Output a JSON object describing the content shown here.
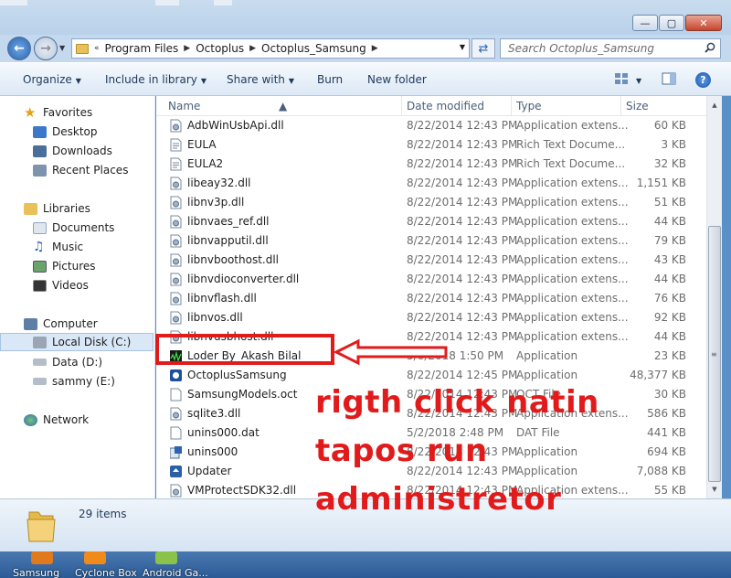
{
  "window": {
    "controls": {
      "minimize": "—",
      "maximize": "▢",
      "close": "✕"
    }
  },
  "address": {
    "crumbs": [
      "Program Files",
      "Octoplus",
      "Octoplus_Samsung"
    ],
    "search_placeholder": "Search Octoplus_Samsung"
  },
  "toolbar": {
    "organize": "Organize",
    "include": "Include in library",
    "share": "Share with",
    "burn": "Burn",
    "new_folder": "New folder"
  },
  "nav": {
    "favorites": "Favorites",
    "desktop": "Desktop",
    "downloads": "Downloads",
    "recent": "Recent Places",
    "libraries": "Libraries",
    "documents": "Documents",
    "music": "Music",
    "pictures": "Pictures",
    "videos": "Videos",
    "computer": "Computer",
    "local_disk": "Local Disk (C:)",
    "data_disk": "Data (D:)",
    "sammy_disk": "sammy (E:)",
    "network": "Network"
  },
  "columns": {
    "name": "Name",
    "date": "Date modified",
    "type": "Type",
    "size": "Size"
  },
  "files": [
    {
      "name": "AdbWinUsbApi.dll",
      "date": "8/22/2014 12:43 PM",
      "type": "Application extens...",
      "size": "60 KB",
      "icon": "dll-icon"
    },
    {
      "name": "EULA",
      "date": "8/22/2014 12:43 PM",
      "type": "Rich Text Docume...",
      "size": "3 KB",
      "icon": "rtf-icon"
    },
    {
      "name": "EULA2",
      "date": "8/22/2014 12:43 PM",
      "type": "Rich Text Docume...",
      "size": "32 KB",
      "icon": "rtf-icon"
    },
    {
      "name": "libeay32.dll",
      "date": "8/22/2014 12:43 PM",
      "type": "Application extens...",
      "size": "1,151 KB",
      "icon": "dll-icon"
    },
    {
      "name": "libnv3p.dll",
      "date": "8/22/2014 12:43 PM",
      "type": "Application extens...",
      "size": "51 KB",
      "icon": "dll-icon"
    },
    {
      "name": "libnvaes_ref.dll",
      "date": "8/22/2014 12:43 PM",
      "type": "Application extens...",
      "size": "44 KB",
      "icon": "dll-icon"
    },
    {
      "name": "libnvapputil.dll",
      "date": "8/22/2014 12:43 PM",
      "type": "Application extens...",
      "size": "79 KB",
      "icon": "dll-icon"
    },
    {
      "name": "libnvboothost.dll",
      "date": "8/22/2014 12:43 PM",
      "type": "Application extens...",
      "size": "43 KB",
      "icon": "dll-icon"
    },
    {
      "name": "libnvdioconverter.dll",
      "date": "8/22/2014 12:43 PM",
      "type": "Application extens...",
      "size": "44 KB",
      "icon": "dll-icon"
    },
    {
      "name": "libnvflash.dll",
      "date": "8/22/2014 12:43 PM",
      "type": "Application extens...",
      "size": "76 KB",
      "icon": "dll-icon"
    },
    {
      "name": "libnvos.dll",
      "date": "8/22/2014 12:43 PM",
      "type": "Application extens...",
      "size": "92 KB",
      "icon": "dll-icon"
    },
    {
      "name": "libnvusbhost.dll",
      "date": "8/22/2014 12:43 PM",
      "type": "Application extens...",
      "size": "44 KB",
      "icon": "dll-icon"
    },
    {
      "name": "Loder By_Akash Bilal",
      "date": "5/6/2018 1:50 PM",
      "type": "Application",
      "size": "23 KB",
      "icon": "loader-app-icon"
    },
    {
      "name": "OctoplusSamsung",
      "date": "8/22/2014 12:45 PM",
      "type": "Application",
      "size": "48,377 KB",
      "icon": "octoplus-app-icon"
    },
    {
      "name": "SamsungModels.oct",
      "date": "8/22/2014 12:43 PM",
      "type": "OCT File",
      "size": "30 KB",
      "icon": "generic-file-icon"
    },
    {
      "name": "sqlite3.dll",
      "date": "8/22/2014 12:43 PM",
      "type": "Application extens...",
      "size": "586 KB",
      "icon": "dll-icon"
    },
    {
      "name": "unins000.dat",
      "date": "5/2/2018 2:48 PM",
      "type": "DAT File",
      "size": "441 KB",
      "icon": "generic-file-icon"
    },
    {
      "name": "unins000",
      "date": "8/22/2014 12:43 PM",
      "type": "Application",
      "size": "694 KB",
      "icon": "uninstaller-icon"
    },
    {
      "name": "Updater",
      "date": "8/22/2014 12:43 PM",
      "type": "Application",
      "size": "7,088 KB",
      "icon": "updater-app-icon"
    },
    {
      "name": "VMProtectSDK32.dll",
      "date": "8/22/2014 12:43 PM",
      "type": "Application extens...",
      "size": "55 KB",
      "icon": "dll-icon"
    }
  ],
  "details": {
    "count": "29 items"
  },
  "taskbar": [
    {
      "label": "Samsung",
      "color": "#e07a1c"
    },
    {
      "label": "Cyclone Box",
      "color": "#f08a1a"
    },
    {
      "label": "Android Ga...",
      "color": "#8bc34a"
    }
  ],
  "annotation": {
    "line1": "rigth  click natin",
    "line2": "tapos run",
    "line3": "administretor",
    "color": "#e11b1b"
  }
}
